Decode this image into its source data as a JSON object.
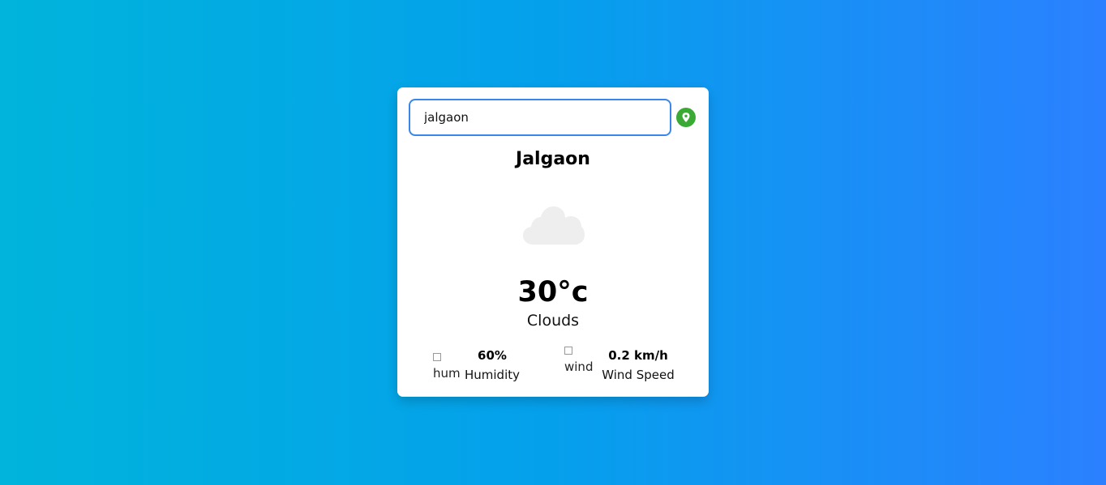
{
  "search": {
    "value": "jalgaon",
    "location_icon": "map-pin-icon",
    "location_color": "#3aaa35"
  },
  "weather": {
    "city": "Jalgaon",
    "icon": "cloud-icon",
    "temperature": "30°c",
    "description": "Clouds"
  },
  "details": {
    "humidity": {
      "value": "60%",
      "label": "Humidity",
      "img_alt": "hum"
    },
    "wind": {
      "value": "0.2 km/h",
      "label": "Wind Speed",
      "img_alt": "wind"
    }
  },
  "colors": {
    "background_start": "#00b4db",
    "background_end": "#2b80ff",
    "input_border": "#3a86ea"
  }
}
